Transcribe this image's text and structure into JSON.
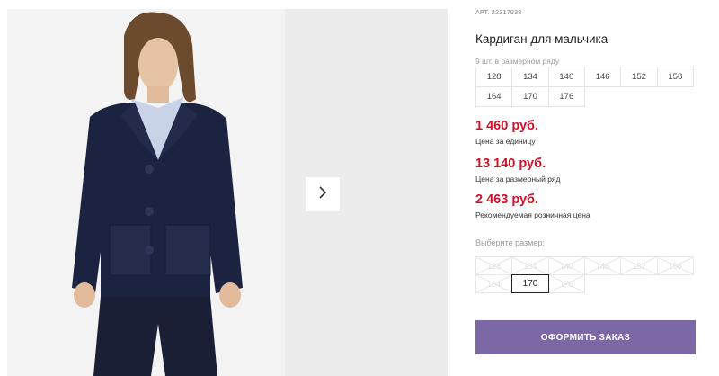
{
  "product": {
    "art_prefix": "АРТ.",
    "art_number": "22317038",
    "title": "Кардиган для мальчика",
    "size_count": "9 шт. в размерном ряду",
    "sizes": [
      "128",
      "134",
      "140",
      "146",
      "152",
      "158",
      "164",
      "170",
      "176"
    ],
    "prices": [
      {
        "value": "1 460 руб.",
        "label": "Цена за единицу"
      },
      {
        "value": "13 140 руб.",
        "label": "Цена за размерный ряд"
      },
      {
        "value": "2 463 руб.",
        "label": "Рекомендуемая розничная цена"
      }
    ],
    "choose_label": "Выберите размер:",
    "choose_sizes": [
      {
        "size": "128",
        "available": false
      },
      {
        "size": "134",
        "available": false
      },
      {
        "size": "140",
        "available": false
      },
      {
        "size": "146",
        "available": false
      },
      {
        "size": "152",
        "available": false
      },
      {
        "size": "158",
        "available": false
      },
      {
        "size": "164",
        "available": false
      },
      {
        "size": "170",
        "available": true,
        "selected": true
      },
      {
        "size": "176",
        "available": false
      }
    ],
    "order_button": "ОФОРМИТЬ ЗАКАЗ"
  },
  "gallery": {
    "next_icon": "chevron-right-icon"
  },
  "colors": {
    "price": "#d0112b",
    "order_button": "#7d68a6",
    "cardigan": "#1c2340"
  }
}
